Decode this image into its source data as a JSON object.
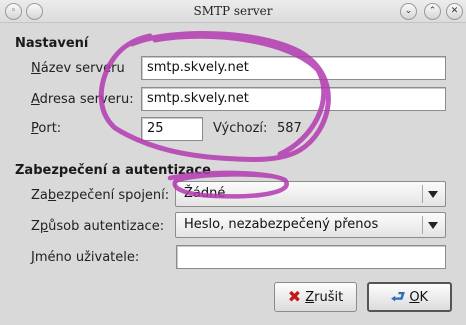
{
  "window": {
    "title": "SMTP server",
    "controls": {
      "menu": "◦",
      "minimize": "⌄",
      "restore": "⌃",
      "close": "✕"
    }
  },
  "settings": {
    "heading": "Nastavení",
    "server_name": {
      "label_mnemonic": "N",
      "label_rest": "ázev serveru",
      "value": "smtp.skvely.net"
    },
    "server_address": {
      "label_mnemonic": "A",
      "label_rest": "dresa serveru:",
      "value": "smtp.skvely.net"
    },
    "port": {
      "label_mnemonic": "P",
      "label_rest": "ort:",
      "value": "25",
      "default_label": "Výchozí:",
      "default_value": "587"
    }
  },
  "security": {
    "heading": "Zabezpečení a autentizace",
    "connection_security": {
      "label_prefix": "Za",
      "label_mnemonic": "b",
      "label_rest": "ezpečení spojení:",
      "value": "Žádné"
    },
    "auth_method": {
      "label_prefix": "Z",
      "label_mnemonic": "p",
      "label_rest": "ůsob autentizace:",
      "value": "Heslo, nezabezpečený přenos"
    },
    "username": {
      "label_mnemonic": "J",
      "label_rest": "méno uživatele:",
      "value": ""
    }
  },
  "buttons": {
    "cancel": {
      "label_mnemonic": "Z",
      "label_rest": "rušit",
      "icon": "cancel-icon"
    },
    "ok": {
      "label_mnemonic": "O",
      "label_rest": "K",
      "icon": "ok-arrow-icon"
    }
  },
  "colors": {
    "annotation": "#b23ab0",
    "window_bg": "#d9d9d9"
  }
}
